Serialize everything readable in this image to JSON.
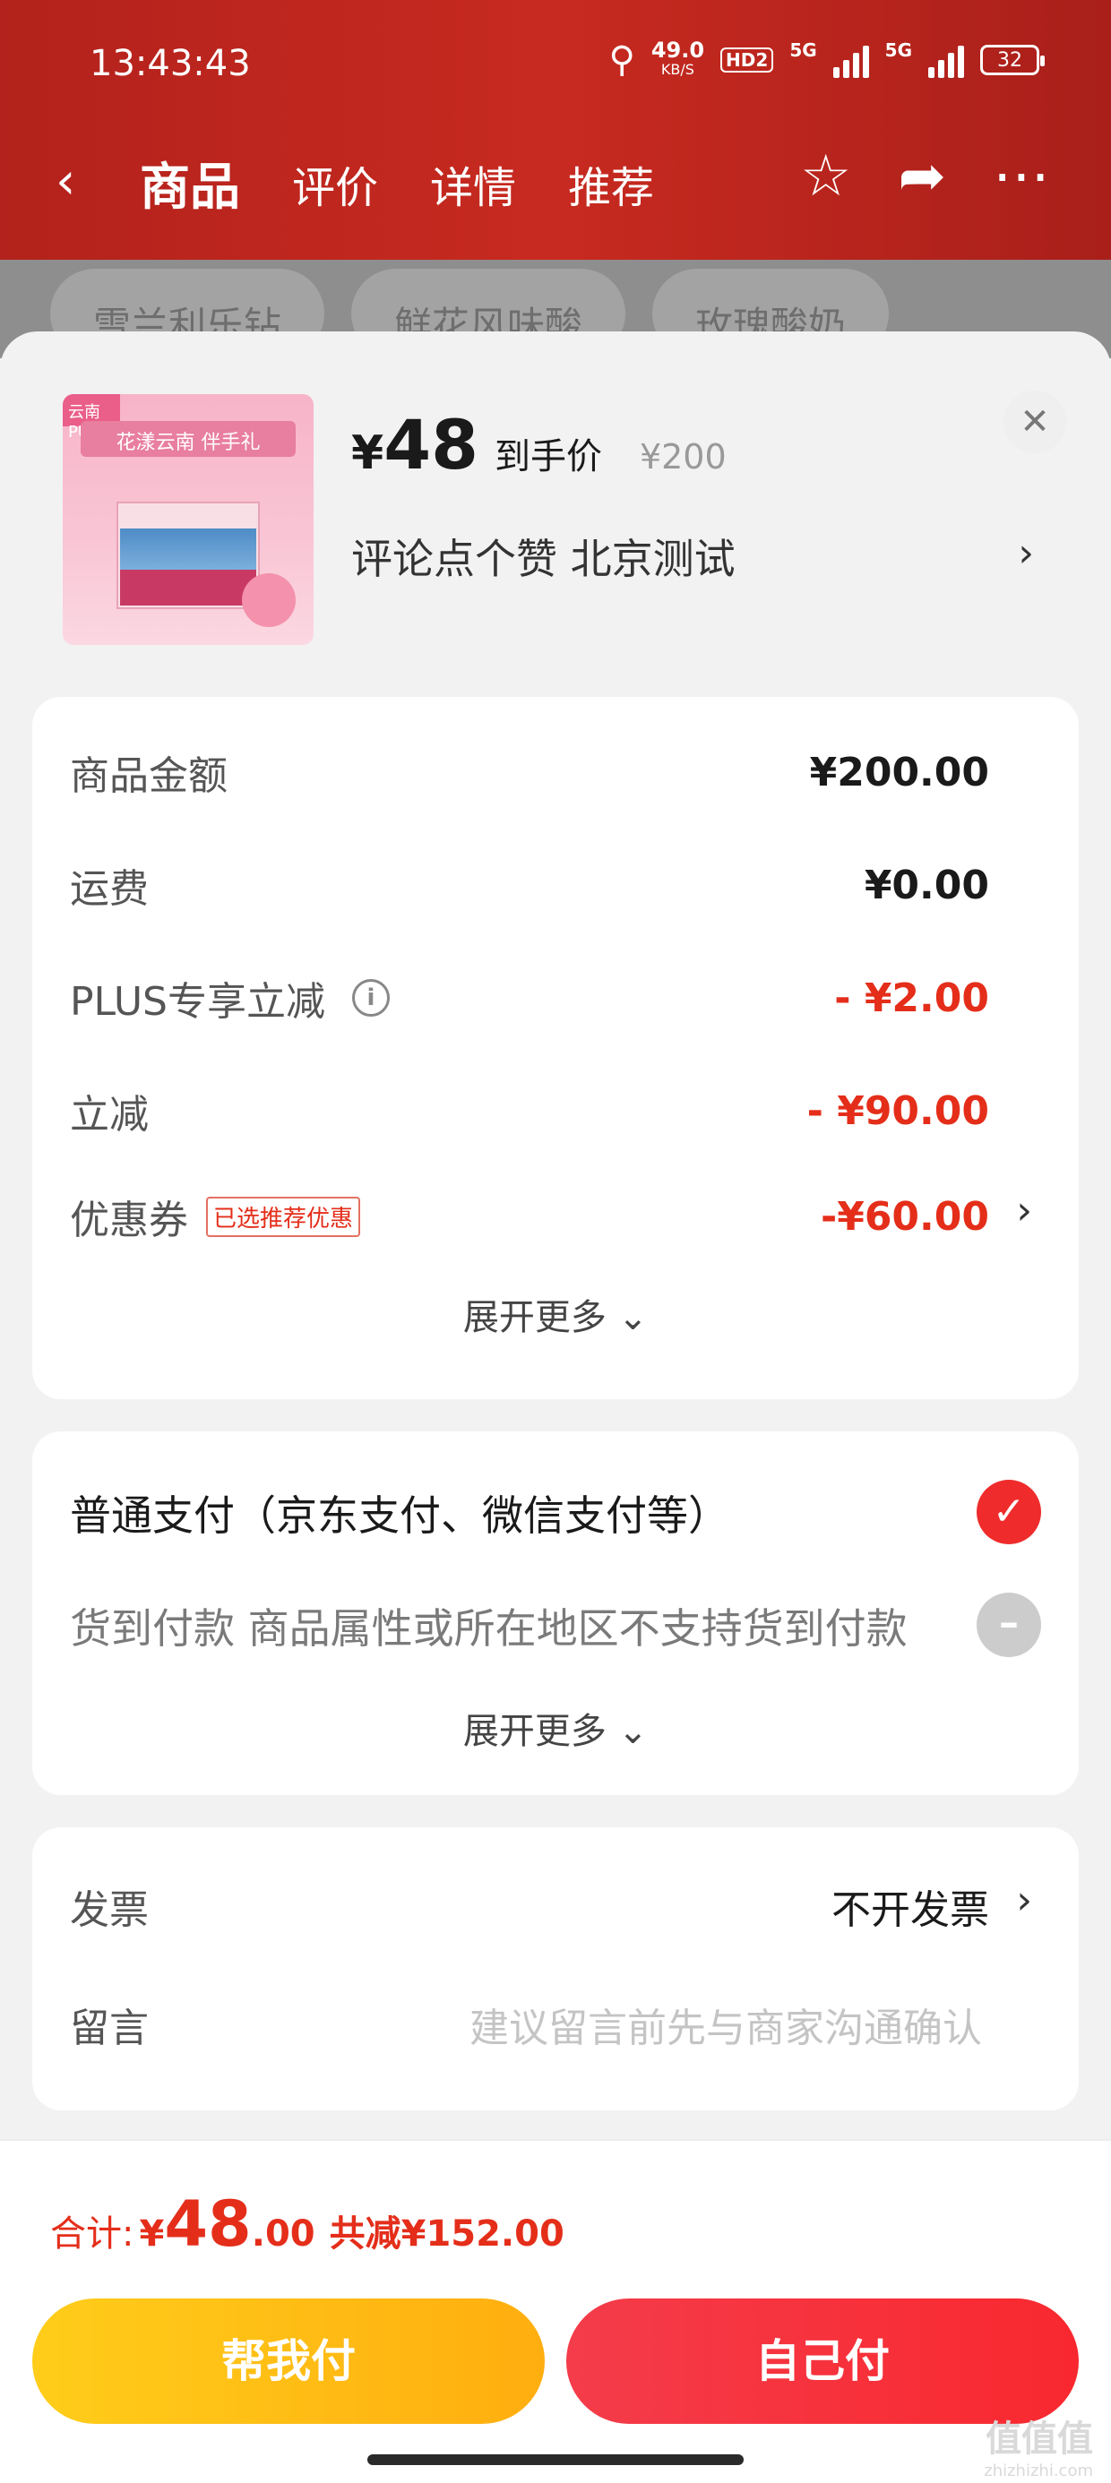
{
  "status_bar": {
    "time": "13:43:43",
    "net_speed": "49.0",
    "net_unit": "KB/S",
    "hd": "HD2",
    "sig1": "5G",
    "sig2": "5G",
    "battery": "32"
  },
  "nav": {
    "tabs": [
      {
        "label": "商品"
      },
      {
        "label": "评价"
      },
      {
        "label": "详情"
      },
      {
        "label": "推荐"
      }
    ]
  },
  "background_chips": [
    "雪兰利乐钻",
    "鲜花风味酸",
    "玫瑰酸奶"
  ],
  "product": {
    "image_badge": "云南PUN",
    "image_title": "花漾云南 伴手礼",
    "price_symbol": "¥",
    "price": "48",
    "price_tag": "到手价",
    "original_price": "¥200",
    "note": "评论点个赞  北京测试"
  },
  "summary": {
    "rows": [
      {
        "label": "商品金额",
        "value": "¥200.00"
      },
      {
        "label": "运费",
        "value": "¥0.00"
      },
      {
        "label": "PLUS专享立减",
        "value": "- ¥2.00"
      },
      {
        "label": "立减",
        "value": "- ¥90.00"
      },
      {
        "label": "优惠券",
        "badge": "已选推荐优惠",
        "value": "-¥60.00"
      }
    ],
    "expand_label": "展开更多"
  },
  "payment": {
    "options": [
      {
        "label": "普通支付（京东支付、微信支付等）"
      },
      {
        "label": "货到付款 商品属性或所在地区不支持货到付款"
      }
    ],
    "expand_label": "展开更多"
  },
  "invoice": {
    "label": "发票",
    "value": "不开发票"
  },
  "message": {
    "label": "留言",
    "placeholder": "建议留言前先与商家沟通确认"
  },
  "footer": {
    "total_label": "合计:",
    "total_symbol": "¥",
    "total_int": "48",
    "total_dec": ".00",
    "saved": "共减¥152.00",
    "help_pay": "帮我付",
    "self_pay": "自己付"
  },
  "watermark": {
    "text": "值值值",
    "site": "zhizhizhi.com"
  },
  "colors": {
    "accent_red": "#e42e1a",
    "header_red": "#c72a20",
    "help_button": "#ffbf14",
    "self_button": "#f43340"
  }
}
